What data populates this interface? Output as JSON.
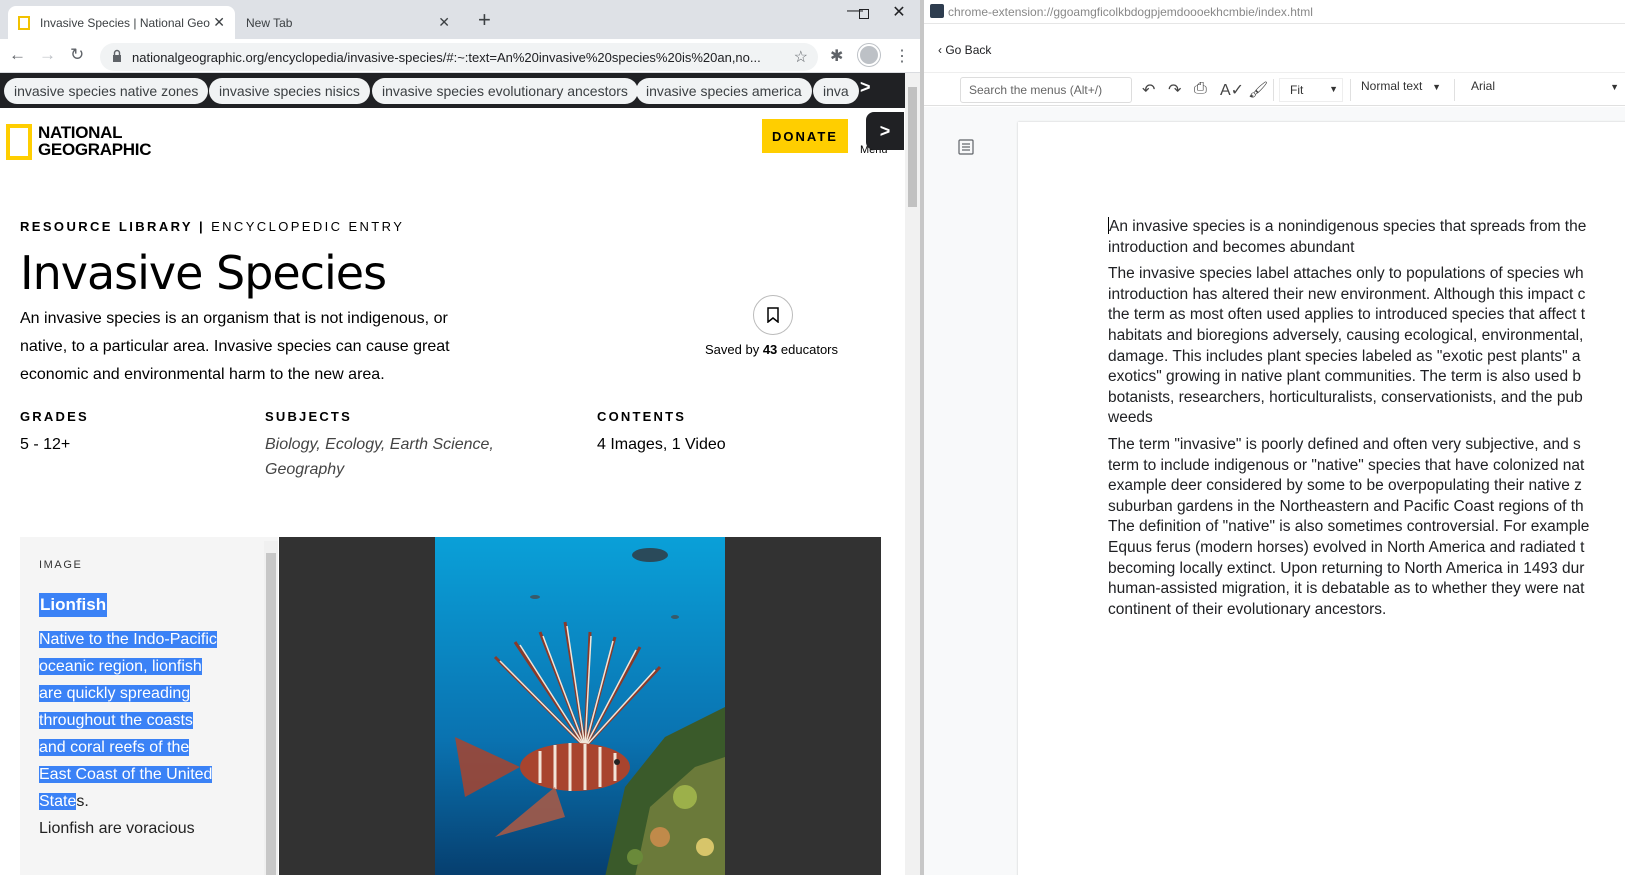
{
  "left": {
    "tabs": [
      {
        "title": "Invasive Species | National Geogr"
      },
      {
        "title": "New Tab"
      }
    ],
    "new_tab": "+",
    "url": "nationalgeographic.org/encyclopedia/invasive-species/#:~:text=An%20invasive%20species%20is%20an,no...",
    "chips": [
      "invasive species native zones",
      "invasive species nisics",
      "invasive species evolutionary ancestors",
      "invasive species america",
      "inva"
    ],
    "chip_more": ">",
    "site": {
      "logo_line1": "NATIONAL",
      "logo_line2": "GEOGRAPHIC",
      "donate": "DONATE",
      "menu": "Menu",
      "side_arrow": ">"
    },
    "article": {
      "eyebrow_bold": "RESOURCE LIBRARY",
      "eyebrow_sep": "|",
      "eyebrow_rest": "ENCYCLOPEDIC ENTRY",
      "title": "Invasive Species",
      "summary": "An invasive species is an organism that is not indigenous, or native, to a particular area. Invasive species can cause great economic and environmental harm to the new area.",
      "saved_prefix": "Saved by",
      "saved_count": "43",
      "saved_suffix": "educators",
      "grades_label": "GRADES",
      "grades_value": "5 - 12+",
      "subjects_label": "SUBJECTS",
      "subjects_value": "Biology, Ecology, Earth Science, Geography",
      "contents_label": "CONTENTS",
      "contents_value": "4 Images, 1 Video"
    },
    "media": {
      "label": "IMAGE",
      "caption_title": "Lionfish",
      "caption_highlight": "Native to the Indo-Pacific oceanic region, lionfish are quickly spreading throughout the coasts and coral reefs of the East Coast of the United State",
      "caption_after": "s.",
      "caption_more": "Lionfish are voracious"
    }
  },
  "right": {
    "url": "chrome-extension://ggoamgficolkbdogpjemdoooekhcmbie/index.html",
    "go_back": "Go Back",
    "menu_search_placeholder": "Search the menus (Alt+/)",
    "zoom": "Fit",
    "style": "Normal text",
    "font": "Arial",
    "doc": {
      "p1": [
        "An invasive species is a nonindigenous species that spreads from the",
        "introduction and becomes abundant"
      ],
      "p2": [
        "The invasive species label attaches only to populations of species wh",
        "introduction has altered their new environment. Although this impact c",
        "the term as most often used applies to introduced species that affect t",
        "habitats and bioregions adversely, causing ecological, environmental,",
        "damage. This includes plant species labeled as \"exotic pest plants\" a",
        "exotics\" growing in native plant communities. The term is also used b",
        "botanists, researchers, horticulturalists, conservationists, and the pub",
        "weeds"
      ],
      "p3": [
        "The term \"invasive\" is poorly defined and often very subjective, and s",
        "term to include indigenous or \"native\" species that have colonized nat",
        "example deer considered by some to be overpopulating their native z",
        "suburban gardens in the Northeastern and Pacific Coast regions of th",
        "The definition of \"native\" is also sometimes controversial. For example",
        "Equus ferus (modern horses) evolved in North America and radiated t",
        "becoming locally extinct. Upon returning to North America in 1493 dur",
        "human-assisted migration, it is debatable as to whether they were nat",
        "continent of their evolutionary ancestors."
      ]
    }
  }
}
